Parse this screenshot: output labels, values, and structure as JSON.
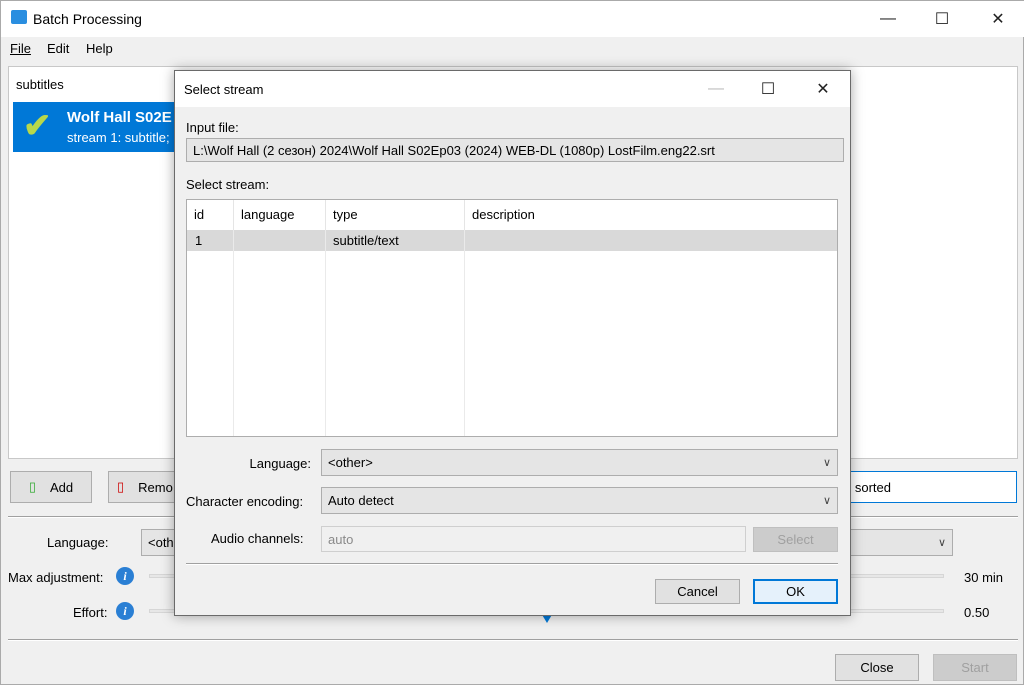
{
  "window": {
    "title": "Batch Processing",
    "minimize": "—",
    "maximize": "☐",
    "close": "✕"
  },
  "menu": [
    "File",
    "Edit",
    "Help"
  ],
  "list": {
    "header": "subtitles",
    "item": {
      "title": "Wolf Hall  S02E",
      "subtitle": "stream 1: subtitle;",
      "icon": "checkmark-icon"
    }
  },
  "buttons": {
    "add": "Add",
    "remove": "Remo",
    "sorted_text": "d sorted",
    "close": "Close",
    "start": "Start"
  },
  "settings": {
    "language_label": "Language:",
    "language_value": "<oth",
    "max_adjustment_label": "Max adjustment:",
    "max_adjustment_value": "30 min",
    "effort_label": "Effort:",
    "effort_value": "0.50",
    "effort_level": 0.5
  },
  "dialog": {
    "title": "Select stream",
    "input_file_label": "Input file:",
    "input_file_value": "L:\\Wolf Hall (2 сезон) 2024\\Wolf Hall S02Ep03 (2024) WEB-DL (1080p) LostFilm.eng22.srt",
    "select_stream_label": "Select stream:",
    "columns": [
      "id",
      "language",
      "type",
      "description"
    ],
    "rows": [
      {
        "id": "1",
        "language": "",
        "type": "subtitle/text",
        "description": ""
      }
    ],
    "language_label": "Language:",
    "language_value": "<other>",
    "encoding_label": "Character encoding:",
    "encoding_value": "Auto detect",
    "audio_label": "Audio channels:",
    "audio_value": "auto",
    "select_button": "Select",
    "cancel": "Cancel",
    "ok": "OK"
  },
  "colors": {
    "selection": "#0078d7",
    "accent": "#2a7fd4"
  }
}
